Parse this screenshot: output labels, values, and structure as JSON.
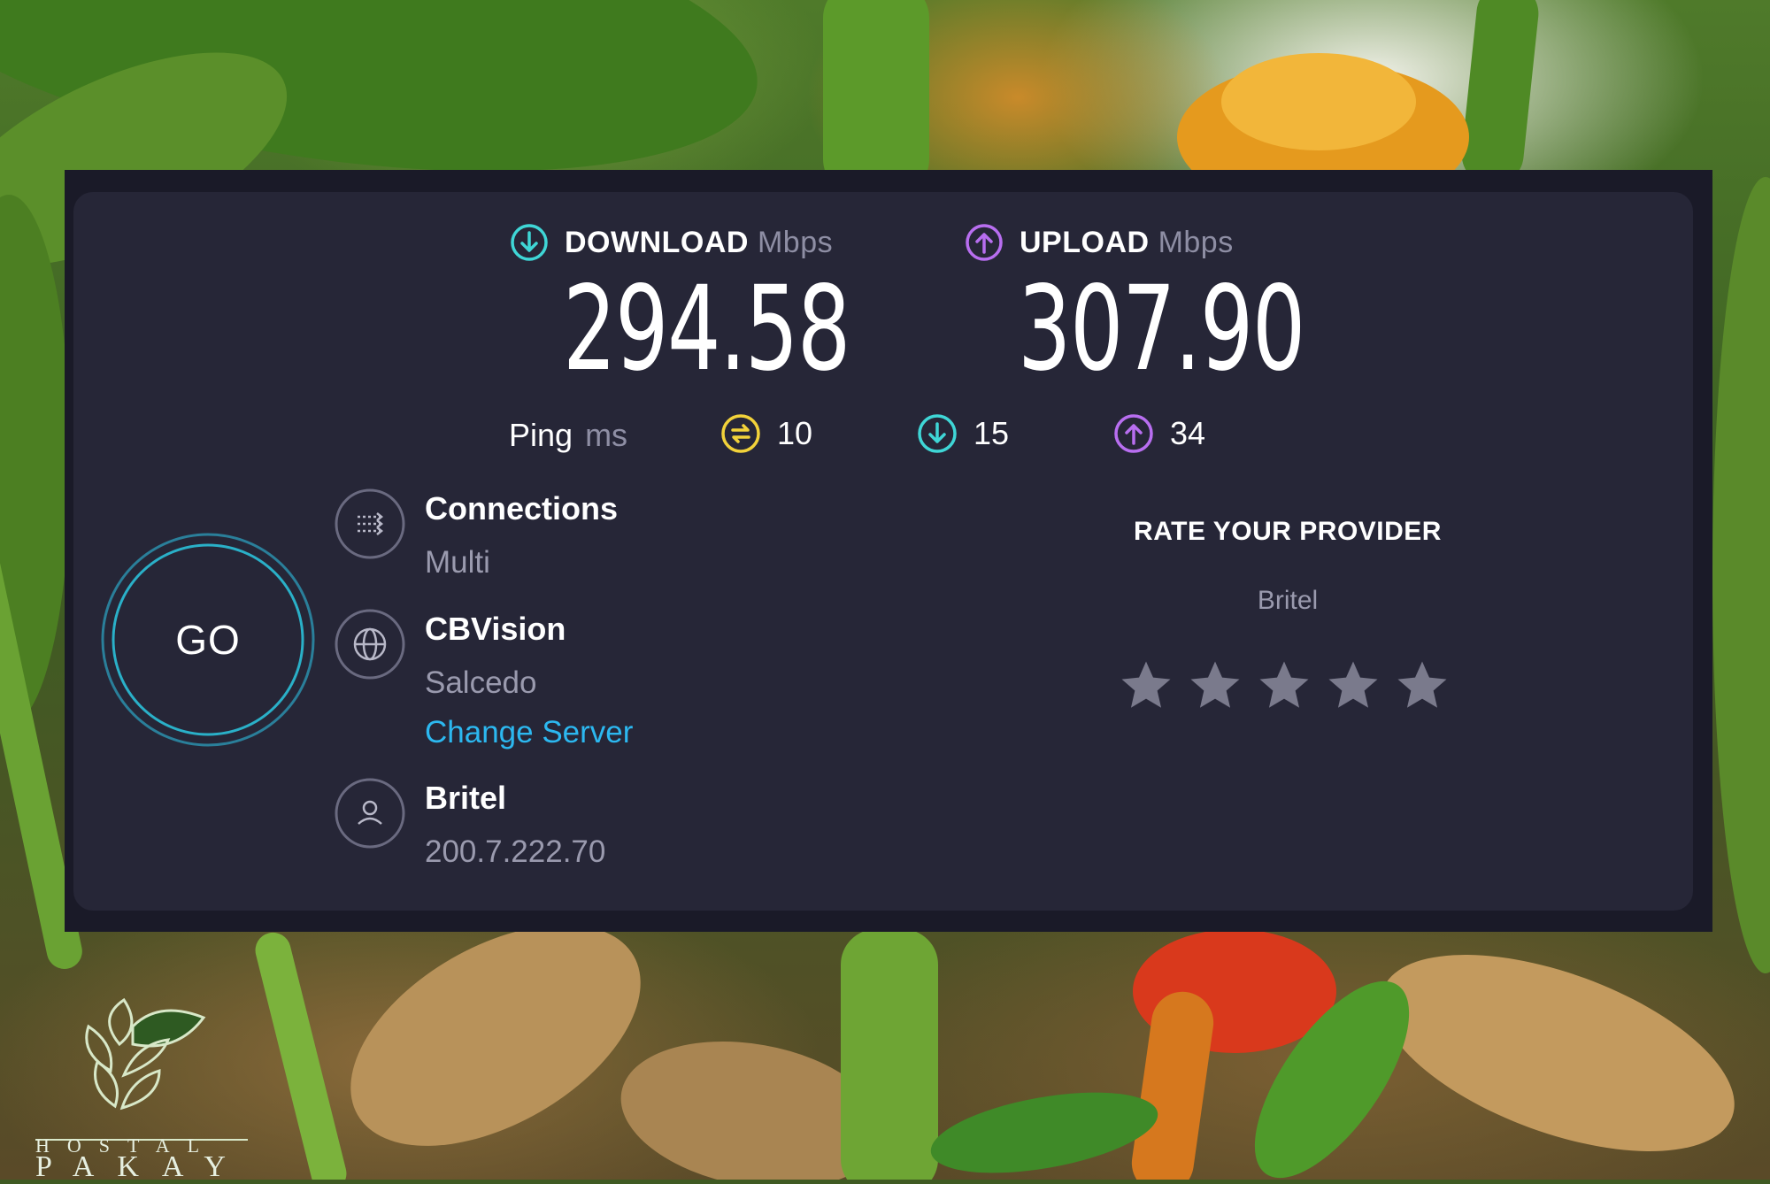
{
  "download": {
    "label": "DOWNLOAD",
    "unit": "Mbps",
    "value": "294.58",
    "icon": "download-arrow-icon",
    "color": "#3fd6d6"
  },
  "upload": {
    "label": "UPLOAD",
    "unit": "Mbps",
    "value": "307.90",
    "icon": "upload-arrow-icon",
    "color": "#b86ef0"
  },
  "ping": {
    "label": "Ping",
    "unit": "ms",
    "idle": {
      "value": "10",
      "icon": "ping-idle-icon",
      "color": "#f2d23a"
    },
    "download": {
      "value": "15",
      "icon": "download-arrow-icon",
      "color": "#3fd6d6"
    },
    "upload": {
      "value": "34",
      "icon": "upload-arrow-icon",
      "color": "#b86ef0"
    }
  },
  "go_button": {
    "label": "GO"
  },
  "connections": {
    "title": "Connections",
    "value": "Multi",
    "icon": "connections-icon"
  },
  "server": {
    "title": "CBVision",
    "location": "Salcedo",
    "change_label": "Change Server",
    "icon": "globe-icon"
  },
  "provider": {
    "title": "Britel",
    "ip": "200.7.222.70",
    "icon": "user-icon"
  },
  "rating": {
    "title": "RATE YOUR PROVIDER",
    "provider": "Britel",
    "stars_total": 5,
    "stars_selected": 0
  },
  "watermark": {
    "line1": "HOSTAL",
    "line2": "PAKAY"
  },
  "colors": {
    "panel_bg": "#262637",
    "accent_link": "#2cb8f0",
    "go_ring": "#2ab0c8"
  }
}
